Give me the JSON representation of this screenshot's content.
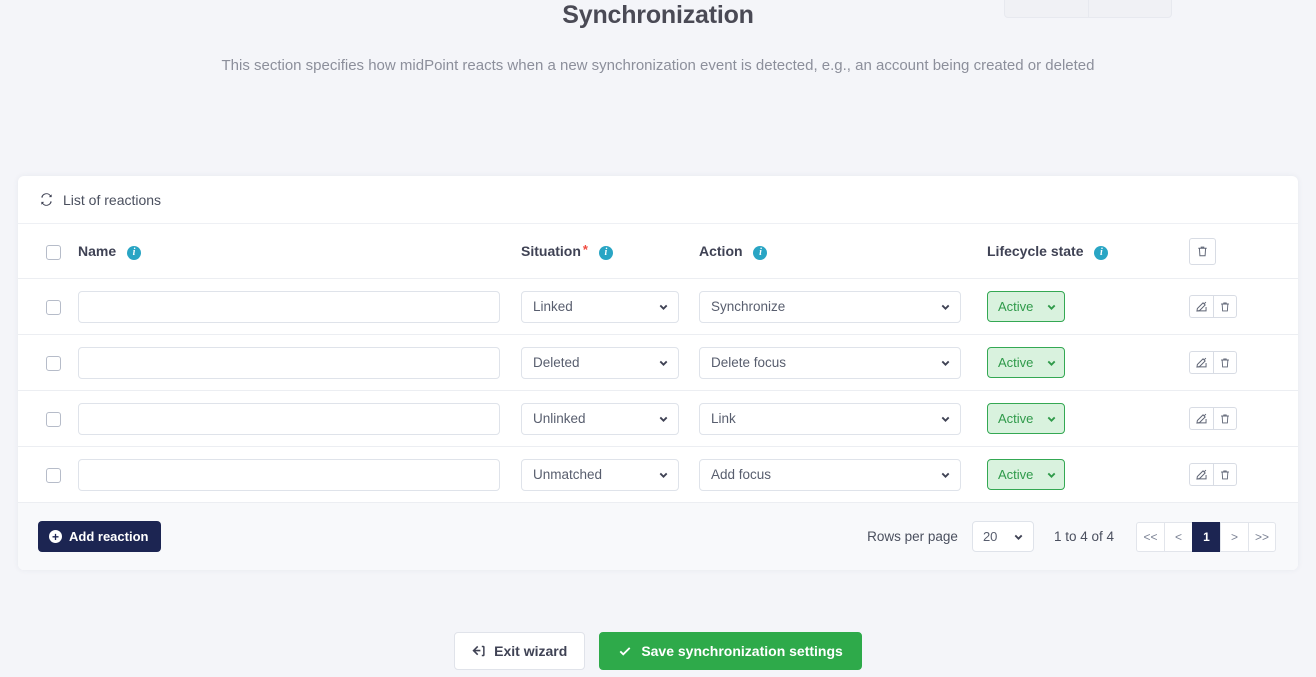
{
  "page": {
    "title": "Synchronization",
    "subtitle": "This section specifies how midPoint reacts when a new synchronization event is detected, e.g., an account being created or deleted"
  },
  "card": {
    "header_label": "List of reactions",
    "header_icon": "sync-icon",
    "columns": {
      "name": "Name",
      "situation": "Situation",
      "situation_required_marker": "*",
      "action": "Action",
      "lifecycle": "Lifecycle state",
      "tools_icon": "trash-icon"
    },
    "rows": [
      {
        "name": "",
        "situation": "Linked",
        "action": "Synchronize",
        "lifecycle": "Active"
      },
      {
        "name": "",
        "situation": "Deleted",
        "action": "Delete focus",
        "lifecycle": "Active"
      },
      {
        "name": "",
        "situation": "Unlinked",
        "action": "Link",
        "lifecycle": "Active"
      },
      {
        "name": "",
        "situation": "Unmatched",
        "action": "Add focus",
        "lifecycle": "Active"
      }
    ],
    "footer": {
      "add_button": "Add reaction",
      "rows_per_page_label": "Rows per page",
      "rows_per_page_value": "20",
      "range_label": "1 to 4 of 4",
      "pager": {
        "first": "<<",
        "prev": "<",
        "current": "1",
        "next": ">",
        "last": ">>"
      }
    }
  },
  "bottom": {
    "exit_label": "Exit wizard",
    "save_label": "Save synchronization settings"
  },
  "colors": {
    "page_background": "#f4f5f9",
    "card_background": "#ffffff",
    "primary_dark": "#1c2552",
    "success_green": "#2eaa4a",
    "badge_green_bg": "#d9f2de",
    "badge_green_text": "#2f9a4a",
    "info_icon": "#29a5c4",
    "required_star": "#f04a3f"
  }
}
